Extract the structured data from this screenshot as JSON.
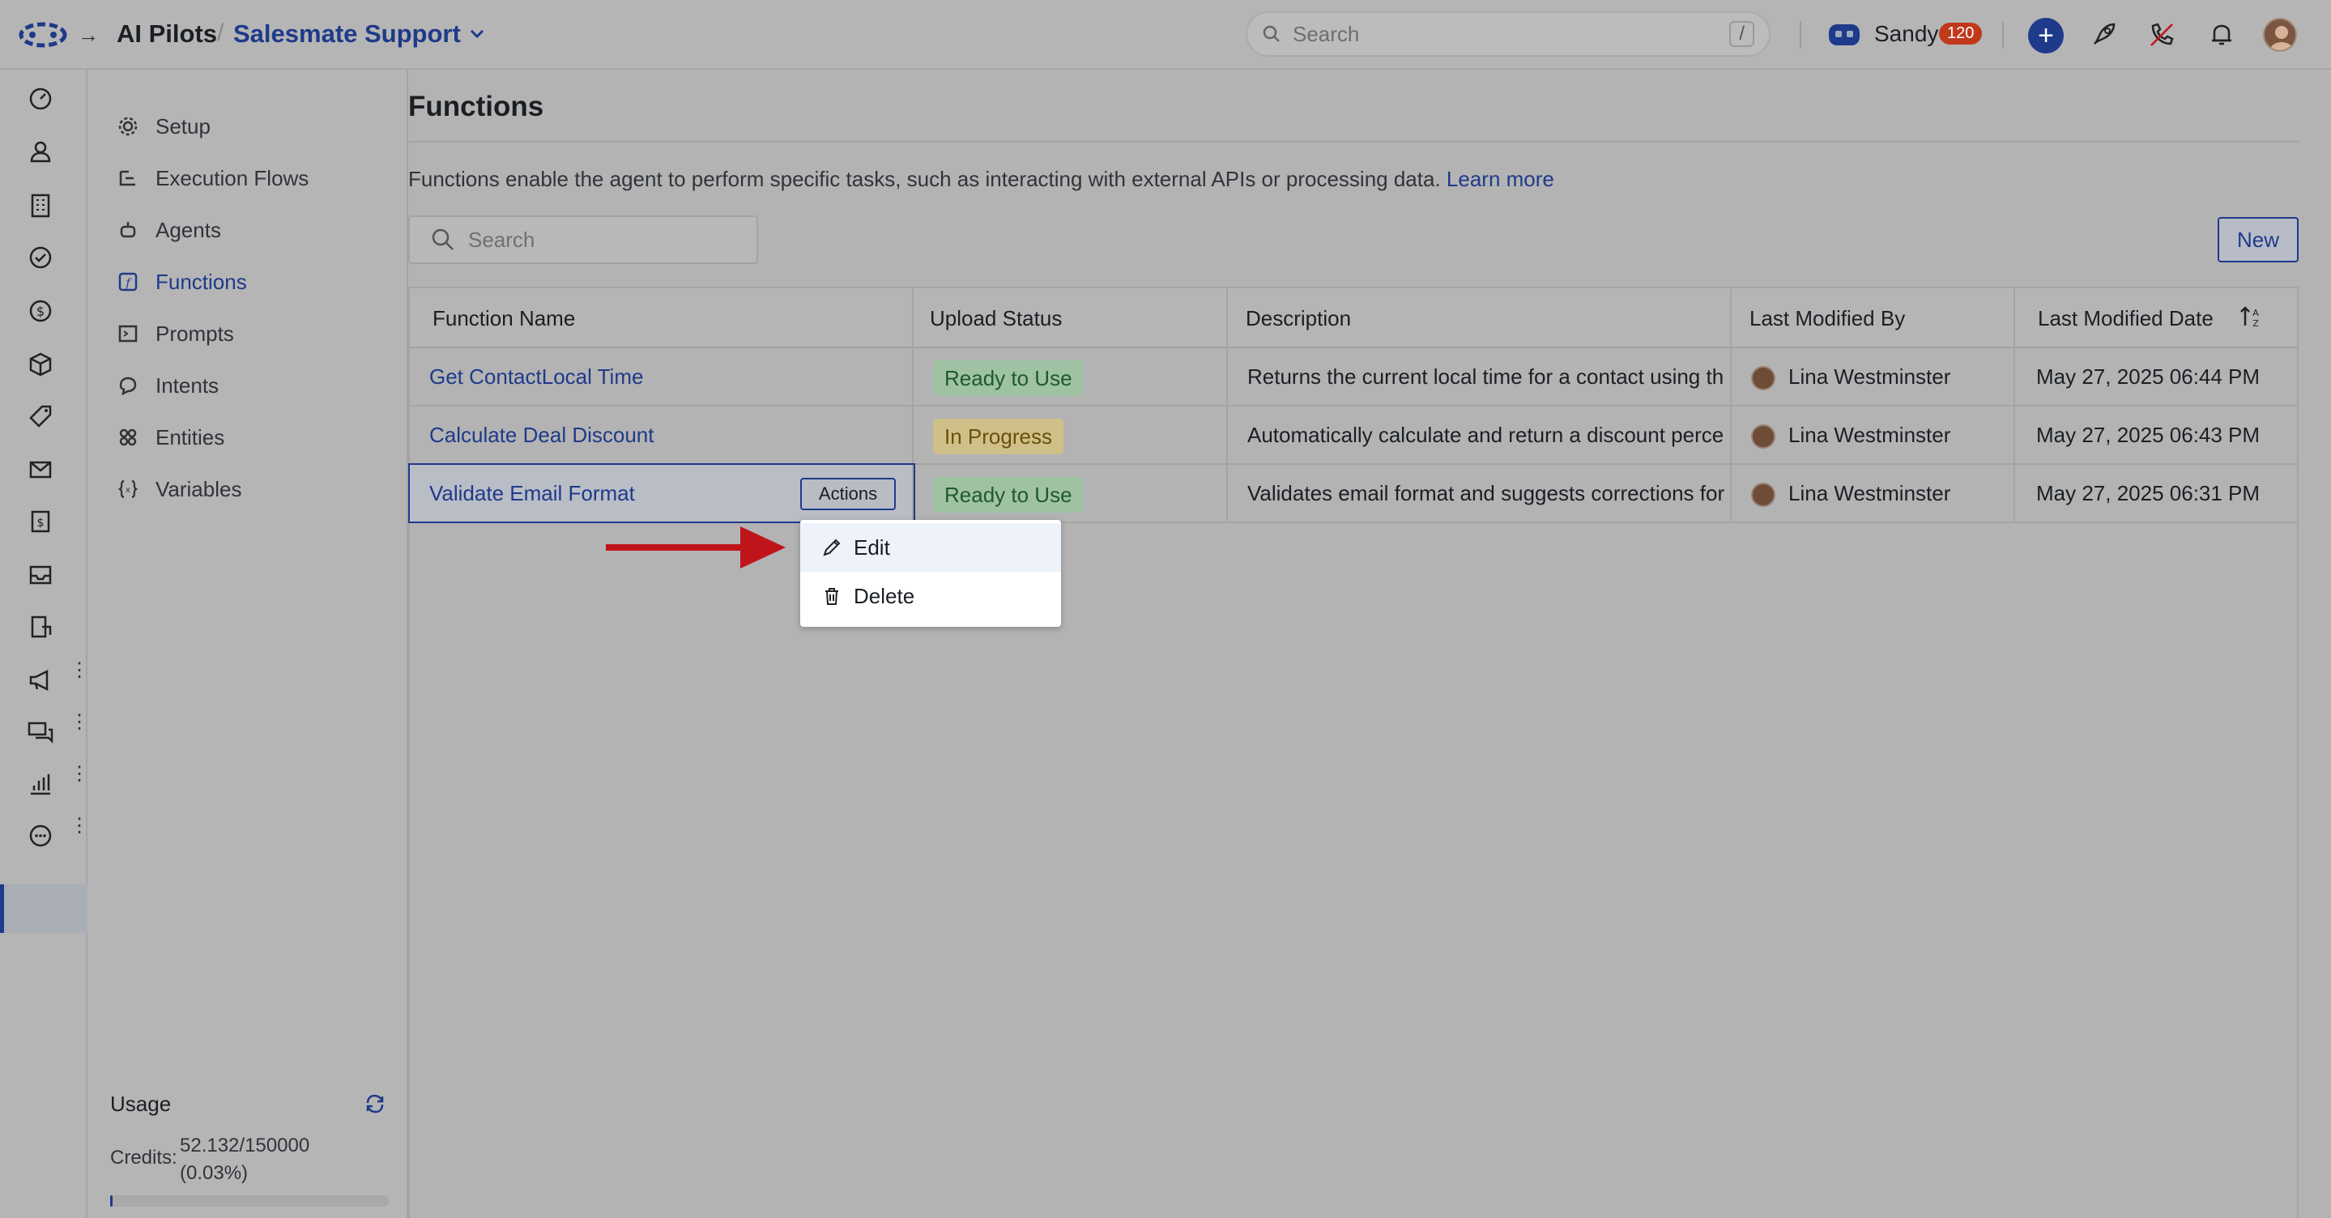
{
  "header": {
    "app_title": "AI Pilots",
    "separator": "/",
    "workspace": "Salesmate Support",
    "search_placeholder": "Search",
    "search_shortcut": "/",
    "user_name": "Sandy",
    "user_badge": "120"
  },
  "subnav": {
    "items": [
      {
        "label": "Setup",
        "icon": "gear-icon"
      },
      {
        "label": "Execution Flows",
        "icon": "flow-icon"
      },
      {
        "label": "Agents",
        "icon": "agent-icon"
      },
      {
        "label": "Functions",
        "icon": "function-icon",
        "active": true
      },
      {
        "label": "Prompts",
        "icon": "prompt-icon"
      },
      {
        "label": "Intents",
        "icon": "intent-icon"
      },
      {
        "label": "Entities",
        "icon": "entities-icon"
      },
      {
        "label": "Variables",
        "icon": "variables-icon"
      }
    ],
    "usage": {
      "title": "Usage",
      "credits_label": "Credits:",
      "credits_value": "52.132/150000",
      "credits_percent": "(0.03%)",
      "fraction": 0.0003
    }
  },
  "main": {
    "title": "Functions",
    "description": "Functions enable the agent to perform specific tasks, such as interacting with external APIs or processing data.",
    "learn_more": "Learn more",
    "search_placeholder": "Search",
    "new_button": "New"
  },
  "table": {
    "columns": [
      "Function Name",
      "Upload Status",
      "Description",
      "Last Modified By",
      "Last Modified Date"
    ],
    "rows": [
      {
        "name": "Get ContactLocal Time",
        "status": "Ready to Use",
        "description": "Returns the current local time for a contact using th",
        "modified_by": "Lina Westminster",
        "modified_date": "May 27, 2025 06:44 PM"
      },
      {
        "name": "Calculate Deal Discount",
        "status": "In Progress",
        "description": "Automatically calculate and return a discount perce",
        "modified_by": "Lina Westminster",
        "modified_date": "May 27, 2025 06:43 PM"
      },
      {
        "name": "Validate Email Format",
        "status": "Ready to Use",
        "description": "Validates email format and suggests corrections for",
        "modified_by": "Lina Westminster",
        "modified_date": "May 27, 2025 06:31 PM"
      }
    ],
    "actions_label": "Actions"
  },
  "menu": {
    "edit": "Edit",
    "delete": "Delete"
  },
  "colors": {
    "accent": "#1e3a8a",
    "annotation_arrow": "#c0141b"
  }
}
